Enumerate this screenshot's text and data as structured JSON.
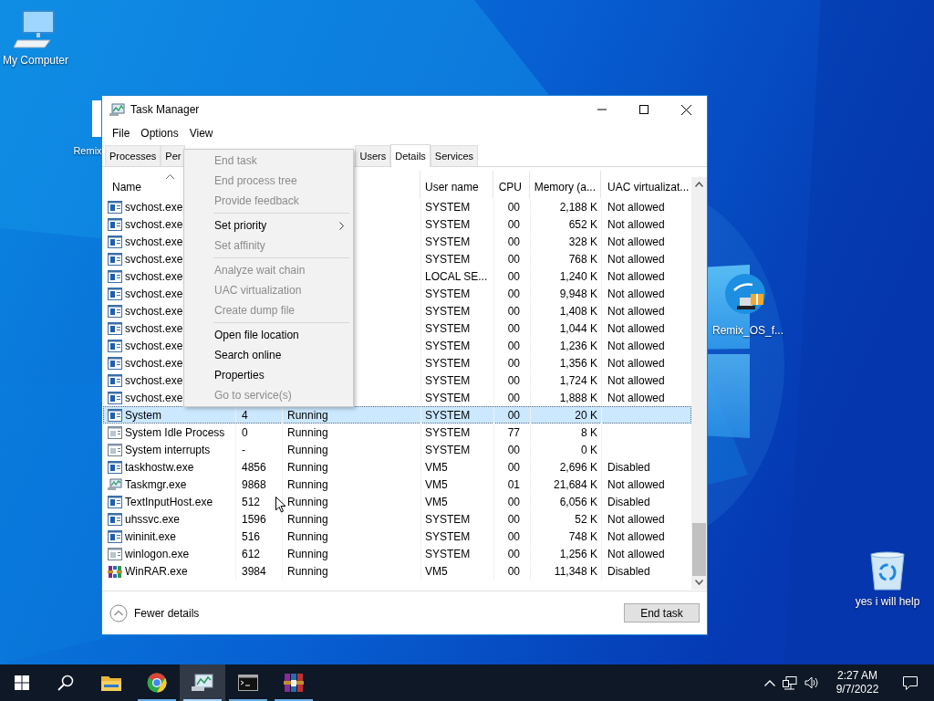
{
  "desktop_icons": [
    {
      "kind": "computer",
      "label": "My Computer"
    },
    {
      "kind": "hidden",
      "label": "Remix"
    },
    {
      "kind": "remix",
      "label": "Remix_OS_f..."
    },
    {
      "kind": "recycle",
      "label": "yes i will help"
    }
  ],
  "window": {
    "title": "Task Manager",
    "menu": [
      "File",
      "Options",
      "View"
    ],
    "tabs": [
      {
        "label": "Processes",
        "selected": false
      },
      {
        "label": "Per",
        "selected": false
      },
      {
        "label": "Users",
        "selected": false
      },
      {
        "label": "Details",
        "selected": true
      },
      {
        "label": "Services",
        "selected": false
      }
    ],
    "columns": [
      {
        "label": "Name",
        "sorted": true
      },
      {
        "label": "User name",
        "sorted": false
      },
      {
        "label": "CPU",
        "sorted": false
      },
      {
        "label": "Memory (a...",
        "sorted": false
      },
      {
        "label": "UAC virtualizat...",
        "sorted": false
      }
    ],
    "rows": [
      {
        "kind": "process",
        "name": "svchost.exe",
        "user": "SYSTEM",
        "cpu": "00",
        "memory": "2,188 K",
        "uac": "Not allowed",
        "selected": false
      },
      {
        "kind": "process",
        "name": "svchost.exe",
        "user": "SYSTEM",
        "cpu": "00",
        "memory": "652 K",
        "uac": "Not allowed",
        "selected": false
      },
      {
        "kind": "process",
        "name": "svchost.exe",
        "user": "SYSTEM",
        "cpu": "00",
        "memory": "328 K",
        "uac": "Not allowed",
        "selected": false
      },
      {
        "kind": "process",
        "name": "svchost.exe",
        "user": "SYSTEM",
        "cpu": "00",
        "memory": "768 K",
        "uac": "Not allowed",
        "selected": false
      },
      {
        "kind": "process",
        "name": "svchost.exe",
        "user": "LOCAL SE...",
        "cpu": "00",
        "memory": "1,240 K",
        "uac": "Not allowed",
        "selected": false
      },
      {
        "kind": "process",
        "name": "svchost.exe",
        "user": "SYSTEM",
        "cpu": "00",
        "memory": "9,948 K",
        "uac": "Not allowed",
        "selected": false
      },
      {
        "kind": "process",
        "name": "svchost.exe",
        "user": "SYSTEM",
        "cpu": "00",
        "memory": "1,408 K",
        "uac": "Not allowed",
        "selected": false
      },
      {
        "kind": "process",
        "name": "svchost.exe",
        "user": "SYSTEM",
        "cpu": "00",
        "memory": "1,044 K",
        "uac": "Not allowed",
        "selected": false
      },
      {
        "kind": "process",
        "name": "svchost.exe",
        "user": "SYSTEM",
        "cpu": "00",
        "memory": "1,236 K",
        "uac": "Not allowed",
        "selected": false
      },
      {
        "kind": "process",
        "name": "svchost.exe",
        "user": "SYSTEM",
        "cpu": "00",
        "memory": "1,356 K",
        "uac": "Not allowed",
        "selected": false
      },
      {
        "kind": "process",
        "name": "svchost.exe",
        "user": "SYSTEM",
        "cpu": "00",
        "memory": "1,724 K",
        "uac": "Not allowed",
        "selected": false
      },
      {
        "kind": "process",
        "name": "svchost.exe",
        "user": "SYSTEM",
        "cpu": "00",
        "memory": "1,888 K",
        "uac": "Not allowed",
        "selected": false
      },
      {
        "kind": "process",
        "name": "System",
        "pid": "4",
        "status": "Running",
        "user": "SYSTEM",
        "cpu": "00",
        "memory": "20 K",
        "selected": true
      },
      {
        "kind": "system",
        "name": "System Idle Process",
        "pid": "0",
        "status": "Running",
        "user": "SYSTEM",
        "cpu": "77",
        "memory": "8 K",
        "selected": false
      },
      {
        "kind": "system",
        "name": "System interrupts",
        "pid": "-",
        "status": "Running",
        "user": "SYSTEM",
        "cpu": "00",
        "memory": "0 K",
        "selected": false
      },
      {
        "kind": "process",
        "name": "taskhostw.exe",
        "pid": "4856",
        "status": "Running",
        "user": "VM5",
        "cpu": "00",
        "memory": "2,696 K",
        "uac": "Disabled",
        "selected": false
      },
      {
        "kind": "taskmgr",
        "name": "Taskmgr.exe",
        "pid": "9868",
        "status": "Running",
        "user": "VM5",
        "cpu": "01",
        "memory": "21,684 K",
        "uac": "Not allowed",
        "selected": false
      },
      {
        "kind": "process",
        "name": "TextInputHost.exe",
        "pid": "512",
        "status": "Running",
        "user": "VM5",
        "cpu": "00",
        "memory": "6,056 K",
        "uac": "Disabled",
        "selected": false
      },
      {
        "kind": "process",
        "name": "uhssvc.exe",
        "pid": "1596",
        "status": "Running",
        "user": "SYSTEM",
        "cpu": "00",
        "memory": "52 K",
        "uac": "Not allowed",
        "selected": false
      },
      {
        "kind": "process",
        "name": "wininit.exe",
        "pid": "516",
        "status": "Running",
        "user": "SYSTEM",
        "cpu": "00",
        "memory": "748 K",
        "uac": "Not allowed",
        "selected": false
      },
      {
        "kind": "system",
        "name": "winlogon.exe",
        "pid": "612",
        "status": "Running",
        "user": "SYSTEM",
        "cpu": "00",
        "memory": "1,256 K",
        "uac": "Not allowed",
        "selected": false
      },
      {
        "kind": "winrar",
        "name": "WinRAR.exe",
        "pid": "3984",
        "status": "Running",
        "user": "VM5",
        "cpu": "00",
        "memory": "11,348 K",
        "uac": "Disabled",
        "selected": false
      }
    ],
    "footer": {
      "toggle": "Fewer details",
      "button": "End task"
    }
  },
  "context_menu": {
    "items": [
      {
        "kind": "item",
        "label": "End task",
        "disabled": true,
        "submenu": false
      },
      {
        "kind": "item",
        "label": "End process tree",
        "disabled": true,
        "submenu": false
      },
      {
        "kind": "item",
        "label": "Provide feedback",
        "disabled": true,
        "submenu": false
      },
      {
        "kind": "separator"
      },
      {
        "kind": "item",
        "label": "Set priority",
        "disabled": false,
        "submenu": true
      },
      {
        "kind": "item",
        "label": "Set affinity",
        "disabled": true,
        "submenu": false
      },
      {
        "kind": "separator"
      },
      {
        "kind": "item",
        "label": "Analyze wait chain",
        "disabled": true,
        "submenu": false
      },
      {
        "kind": "item",
        "label": "UAC virtualization",
        "disabled": true,
        "submenu": false
      },
      {
        "kind": "item",
        "label": "Create dump file",
        "disabled": true,
        "submenu": false
      },
      {
        "kind": "separator"
      },
      {
        "kind": "item",
        "label": "Open file location",
        "disabled": false,
        "submenu": false
      },
      {
        "kind": "item",
        "label": "Search online",
        "disabled": false,
        "submenu": false
      },
      {
        "kind": "item",
        "label": "Properties",
        "disabled": false,
        "submenu": false
      },
      {
        "kind": "item",
        "label": "Go to service(s)",
        "disabled": true,
        "submenu": false
      }
    ]
  },
  "taskbar": {
    "apps": [
      {
        "kind": "start",
        "running": false,
        "selected": false
      },
      {
        "kind": "search",
        "running": false,
        "selected": false
      },
      {
        "kind": "explorer",
        "running": false,
        "selected": false
      },
      {
        "kind": "chrome",
        "running": true,
        "selected": false
      },
      {
        "kind": "taskmgr",
        "running": true,
        "selected": true
      },
      {
        "kind": "terminal",
        "running": true,
        "selected": false
      },
      {
        "kind": "winrar",
        "running": true,
        "selected": false
      }
    ],
    "time": "2:27 AM",
    "date": "9/7/2022"
  }
}
